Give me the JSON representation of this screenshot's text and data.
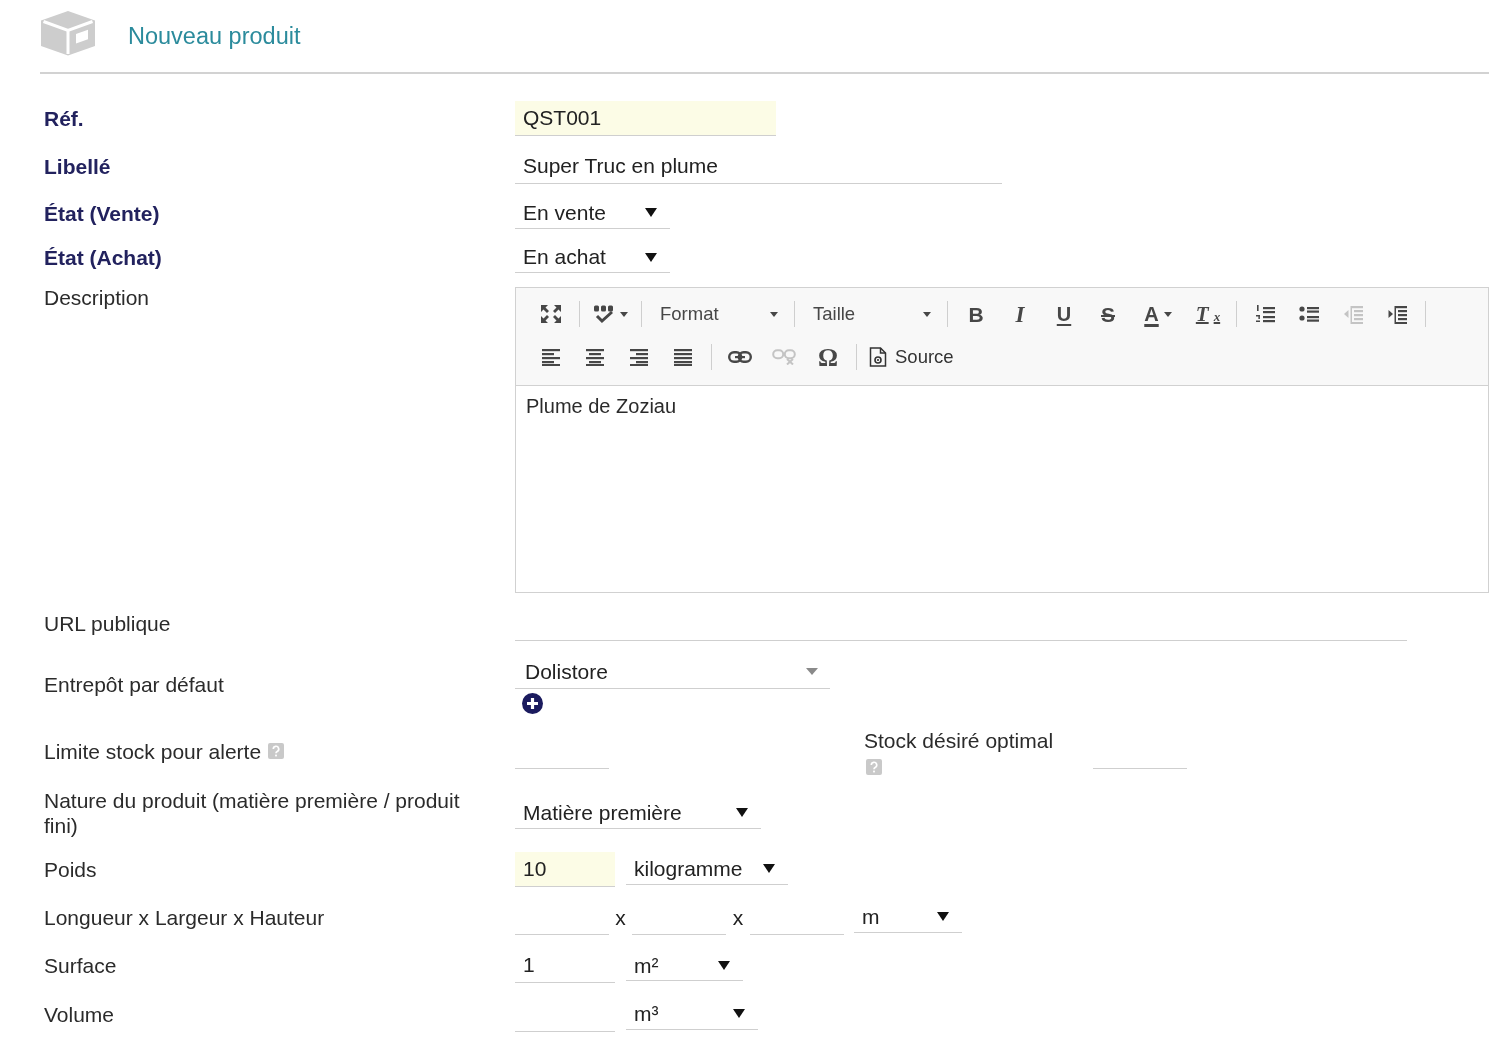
{
  "header": {
    "title": "Nouveau produit"
  },
  "fields": [
    {
      "kind": "line",
      "label": "Réf.",
      "required": true,
      "controls": [
        {
          "kind": "input",
          "value": "QST001",
          "highlighted": true
        }
      ]
    },
    {
      "kind": "line",
      "label": "Libellé",
      "required": true,
      "controls": [
        {
          "kind": "input",
          "value": "Super Truc en plume",
          "highlighted": false
        }
      ]
    },
    {
      "kind": "line",
      "label": "État (Vente)",
      "required": true,
      "controls": [
        {
          "kind": "select",
          "value": "En vente"
        }
      ]
    },
    {
      "kind": "line",
      "label": "État (Achat)",
      "required": true,
      "controls": [
        {
          "kind": "select",
          "value": "En achat"
        }
      ]
    },
    {
      "kind": "editor",
      "label": "Description",
      "required": false,
      "toolbar": [
        [
          [
            {
              "kind": "maximize",
              "disabled": false
            }
          ],
          [
            {
              "kind": "spellcheck",
              "disabled": false
            }
          ],
          [
            {
              "kind": "combo",
              "label": "Format",
              "disabled": false
            }
          ],
          [
            {
              "kind": "combo",
              "label": "Taille",
              "disabled": false
            }
          ],
          [
            {
              "kind": "bold",
              "label": "B",
              "disabled": false
            },
            {
              "kind": "italic",
              "label": "I",
              "disabled": false
            },
            {
              "kind": "underline",
              "label": "U",
              "disabled": false
            },
            {
              "kind": "strike",
              "label": "S",
              "disabled": false
            },
            {
              "kind": "textcolor",
              "label": "A",
              "disabled": false
            },
            {
              "kind": "removeformat",
              "label": "T$_{x}$",
              "disabled": false
            }
          ],
          [
            {
              "kind": "numbered",
              "disabled": false
            },
            {
              "kind": "bulleted",
              "disabled": false
            },
            {
              "kind": "outdent",
              "disabled": true
            },
            {
              "kind": "indent",
              "disabled": false
            }
          ]
        ],
        [
          [
            {
              "kind": "alignleft",
              "disabled": false
            },
            {
              "kind": "aligncenter",
              "disabled": false
            },
            {
              "kind": "alignright",
              "disabled": false
            },
            {
              "kind": "justify",
              "disabled": false
            }
          ],
          [
            {
              "kind": "link",
              "disabled": false
            },
            {
              "kind": "unlink",
              "disabled": true
            },
            {
              "kind": "special",
              "label": "Ω",
              "disabled": false
            }
          ],
          [
            {
              "kind": "source",
              "label": "Source",
              "disabled": false
            }
          ]
        ]
      ],
      "content": "Plume de Zoziau"
    },
    {
      "kind": "line",
      "label": "URL publique",
      "required": false,
      "controls": [
        {
          "kind": "input",
          "highlighted": false
        }
      ]
    },
    {
      "kind": "line",
      "label": "Entrepôt par défaut",
      "required": false,
      "controls": [
        {
          "kind": "search-select",
          "value": "Dolistore"
        },
        {
          "kind": "add"
        }
      ]
    },
    {
      "kind": "line",
      "label": "Limite stock pour alerte",
      "required": false,
      "help": true,
      "controls": [
        {
          "kind": "input",
          "highlighted": false
        },
        {
          "kind": "label",
          "text": "Stock désiré optimal",
          "help": true
        },
        {
          "kind": "input",
          "highlighted": false
        }
      ]
    },
    {
      "kind": "line",
      "label": "Nature du produit (matière première / produit fini)",
      "required": false,
      "controls": [
        {
          "kind": "select",
          "value": "Matière première"
        }
      ]
    },
    {
      "kind": "line",
      "label": "Poids",
      "required": false,
      "controls": [
        {
          "kind": "input",
          "value": "10",
          "highlighted": true
        },
        {
          "kind": "select",
          "value": "kilogramme"
        }
      ]
    },
    {
      "kind": "line",
      "label": "Longueur x Largeur x Hauteur",
      "required": false,
      "controls": [
        {
          "kind": "input",
          "highlighted": false
        },
        {
          "kind": "times",
          "text": "x"
        },
        {
          "kind": "input",
          "highlighted": false
        },
        {
          "kind": "times",
          "text": "x"
        },
        {
          "kind": "input",
          "highlighted": false
        },
        {
          "kind": "select",
          "value": "m"
        }
      ]
    },
    {
      "kind": "line",
      "label": "Surface",
      "required": false,
      "controls": [
        {
          "kind": "input",
          "value": "1",
          "highlighted": false
        },
        {
          "kind": "select",
          "value": "m²"
        }
      ]
    },
    {
      "kind": "line",
      "label": "Volume",
      "required": false,
      "controls": [
        {
          "kind": "input",
          "highlighted": false
        },
        {
          "kind": "select",
          "value": "m³"
        }
      ]
    }
  ]
}
